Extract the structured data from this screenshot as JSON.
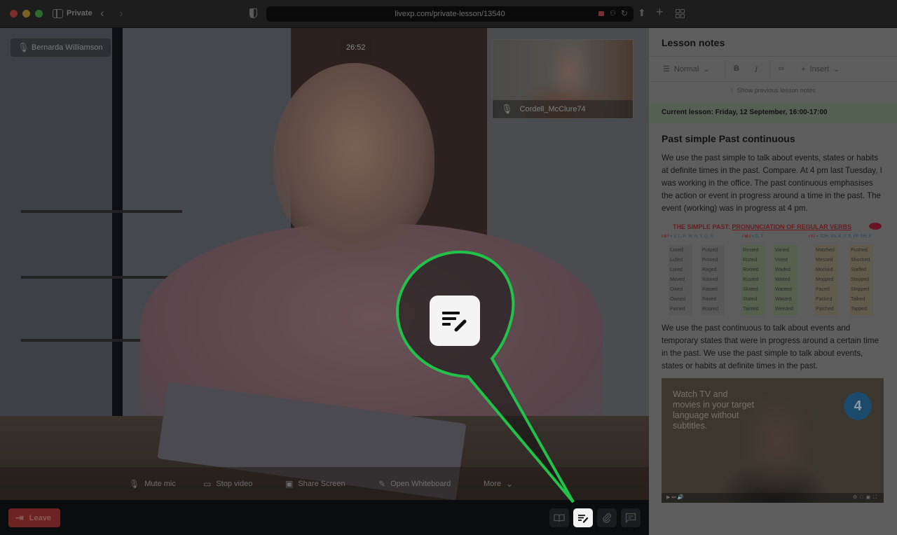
{
  "browser": {
    "private_label": "Private",
    "url": "livexp.com/private-lesson/13540"
  },
  "stage": {
    "participant_name": "Bernarda Williamson",
    "timer": "26:52",
    "pip_name": "Cordell_McClure74",
    "controls": {
      "mute": "Mute mic",
      "video": "Stop video",
      "share": "Share Screen",
      "whiteboard": "Open Whiteboard",
      "more": "More"
    }
  },
  "bottombar": {
    "leave": "Leave",
    "tools": [
      "book",
      "notes",
      "attach",
      "chat"
    ],
    "active_tool": "notes"
  },
  "notes": {
    "title": "Lesson notes",
    "toolbar": {
      "format": "Normal",
      "bold": "B",
      "italic": "I",
      "insert": "Insert"
    },
    "show_previous": "Show previous lesson notes",
    "current_lesson": "Current lesson: Friday, 12 September, 16:00-17:00",
    "heading": "Past simple Past continuous",
    "paragraph_1": "We use the past simple to talk about events, states or habits at definite times in the past. Compare. At 4 pm last Tuesday, I was working in the office. The past continuous emphasises the action or event in progress around a time in the past. The event (working) was in progress at 4 pm.",
    "paragraph_2": "We use the past continuous to talk about events and temporary states that were in progress around a certain time in the past. We use the past simple to talk about events, states or habits at definite times in the past.",
    "verbs_image": {
      "title_a": "THE SIMPLE PAST: ",
      "title_b": "PRONUNCIATION OF REGULAR VERBS",
      "sounds": [
        {
          "sym": "/ d /",
          "rule": "= V, L, R, W, N, Y, G, S"
        },
        {
          "sym": "/ id /",
          "rule": "= D, T"
        },
        {
          "sym": "/ t /",
          "rule": "= TCH, SS, K, P, S, FF, SH, X"
        }
      ],
      "columns": [
        [
          "Loved",
          "Lulled",
          "Lured",
          "Moved",
          "Owed",
          "Owned",
          "Pained"
        ],
        [
          "Prayed",
          "Proved",
          "Raged",
          "Rained",
          "Raised",
          "Raved",
          "Roared"
        ],
        [
          "Rested",
          "Rioted",
          "Rooted",
          "Rusted",
          "Skated",
          "Stated",
          "Tainted"
        ],
        [
          "Varied",
          "Voted",
          "Waded",
          "Waited",
          "Wanted",
          "Wasted",
          "Weeded"
        ],
        [
          "Matched",
          "Messed",
          "Mocked",
          "Mopped",
          "Paced",
          "Packed",
          "Patched"
        ],
        [
          "Pushed",
          "Shocked",
          "Staffed",
          "Stopped",
          "Stripped",
          "Talked",
          "Tapped"
        ]
      ]
    },
    "video": {
      "caption": "Watch TV and movies in your target language without subtitles.",
      "badge": "4"
    }
  },
  "callout": {
    "color": "#22c24a",
    "icon": "notes-edit-icon"
  }
}
